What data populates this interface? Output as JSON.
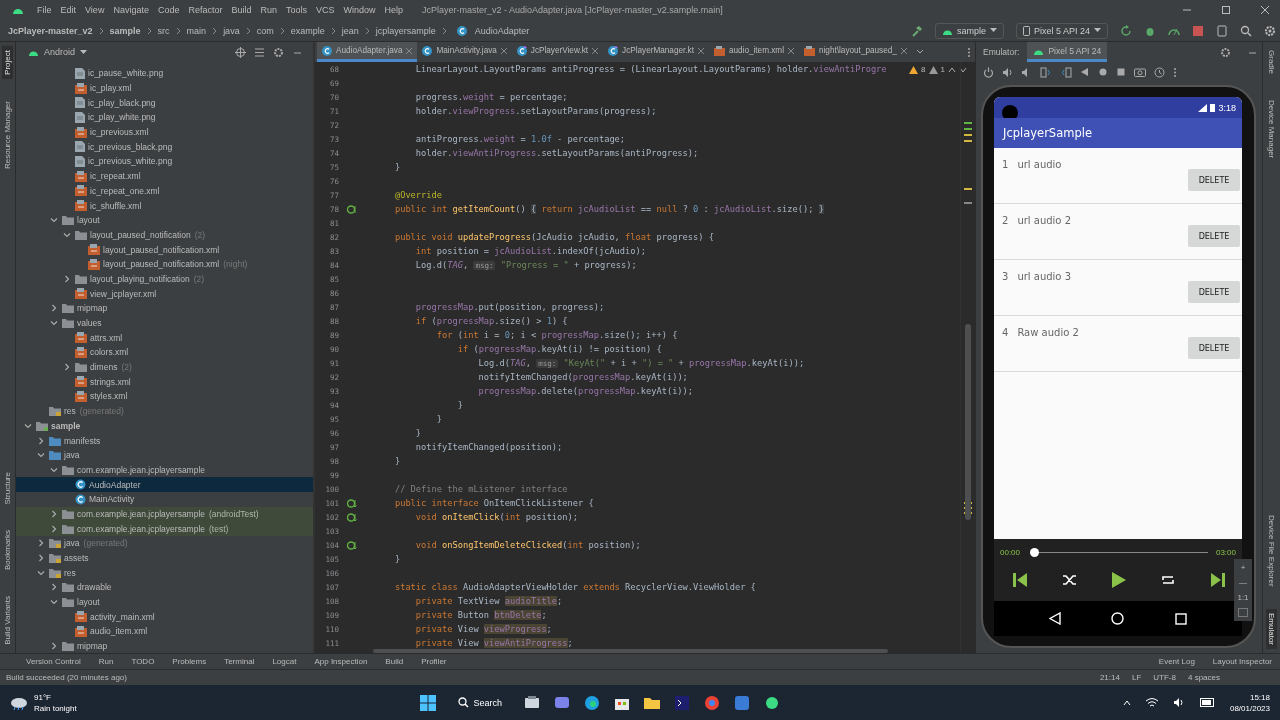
{
  "window": {
    "title": "JcPlayer-master_v2 - AudioAdapter.java [JcPlayer-master_v2.sample.main]"
  },
  "menu": [
    "File",
    "Edit",
    "View",
    "Navigate",
    "Code",
    "Refactor",
    "Build",
    "Run",
    "Tools",
    "VCS",
    "Window",
    "Help"
  ],
  "breadcrumbs": [
    "JcPlayer-master_v2",
    "sample",
    "src",
    "main",
    "java",
    "com",
    "example",
    "jean",
    "jcplayersample",
    "AudioAdapter"
  ],
  "toolbar": {
    "run_config": "sample",
    "device": "Pixel 5 API 24"
  },
  "left_stripe": {
    "top": [
      {
        "label": "Project",
        "selected": true
      },
      {
        "label": "Resource Manager",
        "selected": false
      }
    ],
    "bottom": [
      {
        "label": "Structure",
        "selected": false
      },
      {
        "label": "Bookmarks",
        "selected": false
      },
      {
        "label": "Build Variants",
        "selected": false
      }
    ]
  },
  "right_stripe": {
    "top": [
      {
        "label": "Gradle",
        "selected": false
      },
      {
        "label": "Device Manager",
        "selected": false
      }
    ],
    "bottom": [
      {
        "label": "Device File Explorer",
        "selected": false
      },
      {
        "label": "Emulator",
        "selected": true
      }
    ]
  },
  "project": {
    "view": "Android"
  },
  "tree": {
    "nodes": [
      {
        "children": [
          {
            "children": [
              {
                "children": [
                  {
                    "label": "ic_pause_white.png",
                    "kind": "png",
                    "selected": false
                  },
                  {
                    "label": "ic_play.xml",
                    "kind": "xml",
                    "selected": false
                  },
                  {
                    "label": "ic_play_black.png",
                    "kind": "png",
                    "selected": false
                  },
                  {
                    "label": "ic_play_white.png",
                    "kind": "png",
                    "selected": false
                  },
                  {
                    "label": "ic_previous.xml",
                    "kind": "xml",
                    "selected": false
                  },
                  {
                    "label": "ic_previous_black.png",
                    "kind": "png",
                    "selected": false
                  },
                  {
                    "label": "ic_previous_white.png",
                    "kind": "png",
                    "selected": false
                  },
                  {
                    "label": "ic_repeat.xml",
                    "kind": "xml",
                    "selected": false
                  },
                  {
                    "label": "ic_repeat_one.xml",
                    "kind": "xml",
                    "selected": false
                  },
                  {
                    "label": "ic_shuffle.xml",
                    "kind": "xml",
                    "selected": false
                  }
                ]
              },
              {
                "label": "layout",
                "kind": "folder",
                "expanded": true,
                "selected": false,
                "children": [
                  {
                    "label": "layout_paused_notification",
                    "suffix": "(2)",
                    "kind": "folder",
                    "expanded": true,
                    "selected": false,
                    "children": [
                      {
                        "label": "layout_paused_notification.xml",
                        "kind": "xml",
                        "selected": false
                      },
                      {
                        "label": "layout_paused_notification.xml",
                        "suffix": "(night)",
                        "kind": "xml",
                        "selected": false
                      }
                    ]
                  },
                  {
                    "label": "layout_playing_notification",
                    "suffix": "(2)",
                    "kind": "folder",
                    "expanded": false,
                    "selected": false
                  },
                  {
                    "label": "view_jcplayer.xml",
                    "kind": "xml",
                    "selected": false
                  }
                ]
              },
              {
                "label": "mipmap",
                "kind": "folder",
                "expanded": false,
                "selected": false
              },
              {
                "label": "values",
                "kind": "folder",
                "expanded": true,
                "selected": false,
                "children": [
                  {
                    "label": "attrs.xml",
                    "kind": "xml",
                    "selected": false
                  },
                  {
                    "label": "colors.xml",
                    "kind": "xml",
                    "selected": false
                  },
                  {
                    "label": "dimens",
                    "suffix": "(2)",
                    "kind": "folder",
                    "expanded": false,
                    "selected": false
                  },
                  {
                    "label": "strings.xml",
                    "kind": "xml",
                    "selected": false
                  },
                  {
                    "label": "styles.xml",
                    "kind": "xml",
                    "selected": false
                  }
                ]
              }
            ]
          },
          {
            "label": "res",
            "suffix": "(generated)",
            "kind": "gen-folder",
            "selected": false
          }
        ]
      },
      {
        "label": "sample",
        "kind": "module",
        "expanded": true,
        "selected": false,
        "children": [
          {
            "label": "manifests",
            "kind": "src-folder",
            "expanded": false,
            "selected": false
          },
          {
            "label": "java",
            "kind": "src-folder",
            "expanded": true,
            "selected": false,
            "children": [
              {
                "label": "com.example.jean.jcplayersample",
                "kind": "package",
                "expanded": true,
                "selected": false,
                "children": [
                  {
                    "label": "AudioAdapter",
                    "kind": "class",
                    "selected": true
                  },
                  {
                    "label": "MainActivity",
                    "kind": "class",
                    "selected": false
                  }
                ]
              },
              {
                "label": "com.example.jean.jcplayersample",
                "suffix": "(androidTest)",
                "kind": "test-package",
                "expanded": false,
                "selected": false
              },
              {
                "label": "com.example.jean.jcplayersample",
                "suffix": "(test)",
                "kind": "test-package",
                "expanded": false,
                "selected": false
              }
            ]
          },
          {
            "label": "java",
            "suffix": "(generated)",
            "kind": "gen-folder",
            "expanded": false,
            "selected": false
          },
          {
            "label": "assets",
            "kind": "gen-folder",
            "expanded": false,
            "selected": false
          },
          {
            "label": "res",
            "kind": "gen-folder",
            "expanded": true,
            "selected": false,
            "children": [
              {
                "label": "drawable",
                "kind": "folder",
                "expanded": false,
                "selected": false
              },
              {
                "label": "layout",
                "kind": "folder",
                "expanded": true,
                "selected": false,
                "children": [
                  {
                    "label": "activity_main.xml",
                    "kind": "xml",
                    "selected": false
                  },
                  {
                    "label": "audio_item.xml",
                    "kind": "xml",
                    "selected": false
                  }
                ]
              },
              {
                "label": "mipmap",
                "kind": "folder",
                "expanded": false,
                "selected": false
              }
            ]
          }
        ]
      }
    ]
  },
  "editor": {
    "tabs": [
      {
        "label": "AudioAdapter.java",
        "kind": "java",
        "selected": true
      },
      {
        "label": "MainActivity.java",
        "kind": "java",
        "selected": false
      },
      {
        "label": "JcPlayerView.kt",
        "kind": "kt",
        "selected": false
      },
      {
        "label": "JcPlayerManager.kt",
        "kind": "kt",
        "selected": false
      },
      {
        "label": "audio_item.xml",
        "kind": "xml",
        "selected": false
      },
      {
        "label": "night\\layout_paused_",
        "kind": "xml",
        "selected": false
      }
    ],
    "warnings": "8",
    "weak_warnings": "1",
    "lines": [
      {
        "n": "68",
        "tokens": [
          {
            "kind": "p",
            "text": "        LinearLayout.LayoutParams antiProgress = (LinearLayout.LayoutParams) holder."
          },
          {
            "kind": "f",
            "text": "viewAntiProgre"
          }
        ]
      },
      {
        "n": "69"
      },
      {
        "n": "70",
        "tokens": [
          {
            "kind": "p",
            "text": "        progress."
          },
          {
            "kind": "f",
            "text": "weight"
          },
          {
            "kind": "p",
            "text": " = percentage;"
          }
        ]
      },
      {
        "n": "71",
        "tokens": [
          {
            "kind": "p",
            "text": "        holder."
          },
          {
            "kind": "f",
            "text": "viewProgress"
          },
          {
            "kind": "p",
            "text": ".setLayoutParams(progress);"
          }
        ]
      },
      {
        "n": "72"
      },
      {
        "n": "73",
        "tokens": [
          {
            "kind": "p",
            "text": "        antiProgress."
          },
          {
            "kind": "f",
            "text": "weight"
          },
          {
            "kind": "p",
            "text": " = "
          },
          {
            "kind": "n",
            "text": "1.0f"
          },
          {
            "kind": "p",
            "text": " - percentage;"
          }
        ]
      },
      {
        "n": "74",
        "tokens": [
          {
            "kind": "p",
            "text": "        holder."
          },
          {
            "kind": "f",
            "text": "viewAntiProgress"
          },
          {
            "kind": "p",
            "text": ".setLayoutParams(antiProgress);"
          }
        ]
      },
      {
        "n": "75",
        "tokens": [
          {
            "kind": "p",
            "text": "    }"
          }
        ]
      },
      {
        "n": "76"
      },
      {
        "n": "77",
        "tokens": [
          {
            "kind": "a",
            "text": "    @Override"
          }
        ]
      },
      {
        "n": "78",
        "gutter": {
          "kind": "override"
        },
        "tokens": [
          {
            "kind": "k",
            "text": "    public int "
          },
          {
            "kind": "fn",
            "text": "getItemCount"
          },
          {
            "kind": "p",
            "text": "() "
          },
          {
            "kind": "fo",
            "text": "{"
          },
          {
            "kind": "k",
            "text": " return "
          },
          {
            "kind": "f",
            "text": "jcAudioList"
          },
          {
            "kind": "p",
            "text": " == "
          },
          {
            "kind": "k",
            "text": "null"
          },
          {
            "kind": "p",
            "text": " ? "
          },
          {
            "kind": "n",
            "text": "0"
          },
          {
            "kind": "p",
            "text": " : "
          },
          {
            "kind": "f",
            "text": "jcAudioList"
          },
          {
            "kind": "p",
            "text": ".size(); "
          },
          {
            "kind": "fo",
            "text": "}"
          }
        ]
      },
      {
        "n": "81"
      },
      {
        "n": "82",
        "tokens": [
          {
            "kind": "k",
            "text": "    public void "
          },
          {
            "kind": "fn",
            "text": "updateProgress"
          },
          {
            "kind": "p",
            "text": "(JcAudio jcAudio, "
          },
          {
            "kind": "k",
            "text": "float"
          },
          {
            "kind": "p",
            "text": " progress) {"
          }
        ]
      },
      {
        "n": "83",
        "tokens": [
          {
            "kind": "k",
            "text": "        int"
          },
          {
            "kind": "p",
            "text": " position = "
          },
          {
            "kind": "f",
            "text": "jcAudioList"
          },
          {
            "kind": "p",
            "text": ".indexOf(jcAudio);"
          }
        ]
      },
      {
        "n": "84",
        "tokens": [
          {
            "kind": "p",
            "text": "        Log.d("
          },
          {
            "kind": "fi",
            "text": "TAG"
          },
          {
            "kind": "p",
            "text": ", "
          },
          {
            "kind": "h",
            "text": "msg:"
          },
          {
            "kind": "s",
            "text": " \"Progress = \""
          },
          {
            "kind": "p",
            "text": " + progress);"
          }
        ]
      },
      {
        "n": "85"
      },
      {
        "n": "86"
      },
      {
        "n": "87",
        "tokens": [
          {
            "kind": "f",
            "text": "        progressMap"
          },
          {
            "kind": "p",
            "text": ".put(position, progress);"
          }
        ]
      },
      {
        "n": "88",
        "tokens": [
          {
            "kind": "k",
            "text": "        if"
          },
          {
            "kind": "p",
            "text": " ("
          },
          {
            "kind": "f",
            "text": "progressMap"
          },
          {
            "kind": "p",
            "text": ".size() > "
          },
          {
            "kind": "n",
            "text": "1"
          },
          {
            "kind": "p",
            "text": ") {"
          }
        ]
      },
      {
        "n": "89",
        "tokens": [
          {
            "kind": "k",
            "text": "            for"
          },
          {
            "kind": "p",
            "text": " ("
          },
          {
            "kind": "k",
            "text": "int"
          },
          {
            "kind": "p",
            "text": " i = "
          },
          {
            "kind": "n",
            "text": "0"
          },
          {
            "kind": "p",
            "text": "; i < "
          },
          {
            "kind": "f",
            "text": "progressMap"
          },
          {
            "kind": "p",
            "text": ".size(); i++) {"
          }
        ]
      },
      {
        "n": "90",
        "tokens": [
          {
            "kind": "k",
            "text": "                if"
          },
          {
            "kind": "p",
            "text": " ("
          },
          {
            "kind": "f",
            "text": "progressMap"
          },
          {
            "kind": "p",
            "text": ".keyAt(i) != position) {"
          }
        ]
      },
      {
        "n": "91",
        "tokens": [
          {
            "kind": "p",
            "text": "                    Log.d("
          },
          {
            "kind": "fi",
            "text": "TAG"
          },
          {
            "kind": "p",
            "text": ", "
          },
          {
            "kind": "h",
            "text": "msg:"
          },
          {
            "kind": "s",
            "text": " \"KeyAt(\""
          },
          {
            "kind": "p",
            "text": " + i + "
          },
          {
            "kind": "s",
            "text": "\") = \""
          },
          {
            "kind": "p",
            "text": " + "
          },
          {
            "kind": "f",
            "text": "progressMap"
          },
          {
            "kind": "p",
            "text": ".keyAt(i));"
          }
        ]
      },
      {
        "n": "92",
        "tokens": [
          {
            "kind": "p",
            "text": "                    notifyItemChanged("
          },
          {
            "kind": "f",
            "text": "progressMap"
          },
          {
            "kind": "p",
            "text": ".keyAt(i));"
          }
        ]
      },
      {
        "n": "93",
        "tokens": [
          {
            "kind": "f",
            "text": "                    progressMap"
          },
          {
            "kind": "p",
            "text": ".delete("
          },
          {
            "kind": "f",
            "text": "progressMap"
          },
          {
            "kind": "p",
            "text": ".keyAt(i));"
          }
        ]
      },
      {
        "n": "94",
        "tokens": [
          {
            "kind": "p",
            "text": "                }"
          }
        ]
      },
      {
        "n": "95",
        "tokens": [
          {
            "kind": "p",
            "text": "            }"
          }
        ]
      },
      {
        "n": "96",
        "tokens": [
          {
            "kind": "p",
            "text": "        }"
          }
        ]
      },
      {
        "n": "97",
        "tokens": [
          {
            "kind": "p",
            "text": "        notifyItemChanged(position);"
          }
        ]
      },
      {
        "n": "98",
        "tokens": [
          {
            "kind": "p",
            "text": "    }"
          }
        ]
      },
      {
        "n": "99"
      },
      {
        "n": "100",
        "tokens": [
          {
            "kind": "c",
            "text": "    // Define the mListener interface"
          }
        ]
      },
      {
        "n": "101",
        "gutter": {
          "kind": "implemented"
        },
        "tokens": [
          {
            "kind": "k",
            "text": "    public interface "
          },
          {
            "kind": "p",
            "text": "OnItemClickListener {"
          }
        ]
      },
      {
        "n": "102",
        "gutter": {
          "kind": "implemented"
        },
        "tokens": [
          {
            "kind": "k",
            "text": "        void "
          },
          {
            "kind": "fn",
            "text": "onItemClick"
          },
          {
            "kind": "p",
            "text": "("
          },
          {
            "kind": "k",
            "text": "int"
          },
          {
            "kind": "p",
            "text": " position);"
          }
        ]
      },
      {
        "n": "103"
      },
      {
        "n": "104",
        "gutter": {
          "kind": "implemented"
        },
        "tokens": [
          {
            "kind": "k",
            "text": "        void "
          },
          {
            "kind": "fn",
            "text": "onSongItemDeleteClicked"
          },
          {
            "kind": "p",
            "text": "("
          },
          {
            "kind": "k",
            "text": "int"
          },
          {
            "kind": "p",
            "text": " position);"
          }
        ]
      },
      {
        "n": "105",
        "tokens": [
          {
            "kind": "p",
            "text": "    }"
          }
        ]
      },
      {
        "n": "106"
      },
      {
        "n": "107",
        "tokens": [
          {
            "kind": "k",
            "text": "    static class "
          },
          {
            "kind": "p",
            "text": "AudioAdapterViewHolder "
          },
          {
            "kind": "k",
            "text": "extends "
          },
          {
            "kind": "p",
            "text": "RecyclerView.ViewHolder {"
          }
        ]
      },
      {
        "n": "108",
        "tokens": [
          {
            "kind": "k",
            "text": "        private "
          },
          {
            "kind": "p",
            "text": "TextView "
          },
          {
            "kind": "u",
            "text": "audioTitle"
          },
          {
            "kind": "p",
            "text": ";"
          }
        ]
      },
      {
        "n": "109",
        "tokens": [
          {
            "kind": "k",
            "text": "        private "
          },
          {
            "kind": "p",
            "text": "Button "
          },
          {
            "kind": "u",
            "text": "btnDelete"
          },
          {
            "kind": "p",
            "text": ";"
          }
        ]
      },
      {
        "n": "110",
        "tokens": [
          {
            "kind": "k",
            "text": "        private "
          },
          {
            "kind": "p",
            "text": "View "
          },
          {
            "kind": "u",
            "text": "viewProgress"
          },
          {
            "kind": "p",
            "text": ";"
          }
        ]
      },
      {
        "n": "111",
        "tokens": [
          {
            "kind": "k",
            "text": "        private "
          },
          {
            "kind": "p",
            "text": "View "
          },
          {
            "kind": "u",
            "text": "viewAntiProgress"
          },
          {
            "kind": "p",
            "text": ";"
          }
        ]
      }
    ]
  },
  "emulator": {
    "label": "Emulator:",
    "tab": "Pixel 5 API 24",
    "status_time": "3:18",
    "app_title": "JcplayerSample",
    "items": [
      {
        "number": "1",
        "title": "url audio",
        "button": "DELETE"
      },
      {
        "number": "2",
        "title": "url audio 2",
        "button": "DELETE"
      },
      {
        "number": "3",
        "title": "url audio 3",
        "button": "DELETE"
      },
      {
        "number": "4",
        "title": "Raw audio 2",
        "button": "DELETE"
      }
    ],
    "player": {
      "elapsed": "00:00",
      "total": "03:00",
      "level": 0
    },
    "zoom": {
      "plus": "+",
      "minus": "—",
      "reset": "1:1"
    }
  },
  "tool_windows": {
    "left": [
      "Version Control",
      "Run",
      "TODO",
      "Problems",
      "Terminal",
      "Logcat",
      "App Inspection",
      "Build",
      "Profiler"
    ],
    "right": [
      "Event Log",
      "Layout Inspector"
    ]
  },
  "status_bar": {
    "message": "Build succeeded (20 minutes ago)",
    "items": [
      "21:14",
      "LF",
      "UTF-8",
      "4 spaces"
    ]
  },
  "taskbar": {
    "temperature": "91°F",
    "forecast": "Rain tonight",
    "search": "Search",
    "time": "15:18",
    "date": "08/01/2023"
  }
}
